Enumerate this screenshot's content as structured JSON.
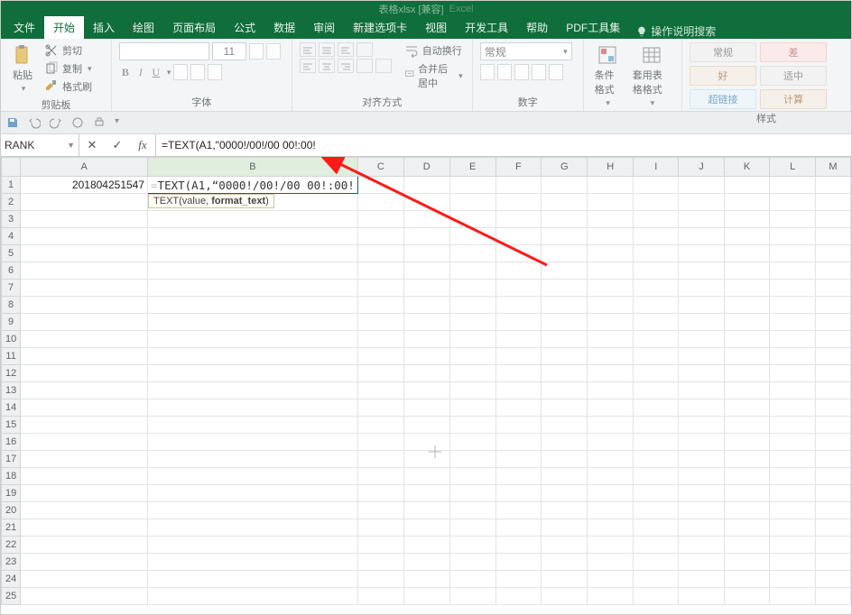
{
  "titlebar": {
    "doc": "表格xlsx [兼容]",
    "app": "Excel"
  },
  "tabs": {
    "items": [
      "文件",
      "开始",
      "插入",
      "绘图",
      "页面布局",
      "公式",
      "数据",
      "审阅",
      "新建选项卡",
      "视图",
      "开发工具",
      "帮助",
      "PDF工具集"
    ],
    "active_index": 1,
    "search_hint": "操作说明搜索"
  },
  "ribbon": {
    "clipboard": {
      "paste": "粘贴",
      "cut": "剪切",
      "copy": "复制",
      "format_painter": "格式刷",
      "label": "剪贴板"
    },
    "font": {
      "name": "",
      "size": "11",
      "label": "字体",
      "bold": "B",
      "italic": "I",
      "underline": "U"
    },
    "align": {
      "wrap": "自动换行",
      "merge": "合并后居中",
      "label": "对齐方式"
    },
    "number": {
      "format": "常规",
      "label": "数字"
    },
    "styles": {
      "cond": "条件格式",
      "table": "套用表格格式",
      "label": "样式",
      "swatches": [
        "常规",
        "差",
        "好",
        "适中",
        "超链接",
        "计算"
      ]
    }
  },
  "qat": {
    "items": [
      "save",
      "undo",
      "redo",
      "touch",
      "print",
      "more"
    ]
  },
  "formula_bar": {
    "name_box": "RANK",
    "cancel": "✕",
    "enter": "✓",
    "fx": "fx",
    "formula": "=TEXT(A1,\"0000!/00!/00 00!:00!"
  },
  "grid": {
    "columns": [
      "A",
      "B",
      "C",
      "D",
      "E",
      "F",
      "G",
      "H",
      "I",
      "J",
      "K",
      "L",
      "M"
    ],
    "rows": 25,
    "active_col": "B",
    "a1_value": "201804251547",
    "b1_prefix": "=",
    "b1_func": "TEXT",
    "b1_args_visible": "(A1,",
    "b1_rest": "\"0000!/00!/00 00!:00!",
    "tooltip_func": "TEXT",
    "tooltip_sig": "(value, ",
    "tooltip_bold": "format_text",
    "tooltip_close": ")"
  }
}
